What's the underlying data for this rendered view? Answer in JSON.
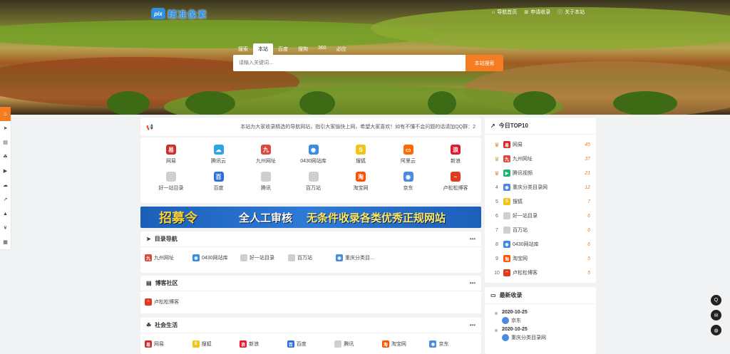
{
  "header": {
    "logo_badge": "pix",
    "logo_text": "精准像素",
    "nav": [
      {
        "icon": "home-icon",
        "glyph": "⌂",
        "label": "导航首页"
      },
      {
        "icon": "plus-square-icon",
        "glyph": "⊞",
        "label": "申请收录"
      },
      {
        "icon": "info-icon",
        "glyph": "ⓘ",
        "label": "关于本站"
      }
    ]
  },
  "search": {
    "tabs": [
      "搜索",
      "本站",
      "百度",
      "搜狗",
      "360",
      "必应"
    ],
    "active_tab": "本站",
    "placeholder": "请输入关键词...",
    "button_label": "本站搜索"
  },
  "notice": {
    "icon": "megaphone-icon",
    "text": "本站为大家收录精选的导航网站，指引大家愉快上网，希望大家喜欢！如有不懂不会问题的话请加QQ群：2"
  },
  "sites": [
    {
      "name": "网易",
      "color": "#d22b2b",
      "glyph": "易"
    },
    {
      "name": "腾讯云",
      "color": "#2fa3e7",
      "glyph": "☁"
    },
    {
      "name": "九州网址",
      "color": "#d94a3c",
      "glyph": "九"
    },
    {
      "name": "0430网站库",
      "color": "#3b8be0",
      "glyph": "◉"
    },
    {
      "name": "搜狐",
      "color": "#f0c419",
      "glyph": "S"
    },
    {
      "name": "阿里云",
      "color": "#ff6a00",
      "glyph": "▭"
    },
    {
      "name": "新浪",
      "color": "#e6162d",
      "glyph": "浪"
    },
    {
      "name": "好一站目录",
      "color": "#cfcfcf",
      "glyph": ""
    },
    {
      "name": "百度",
      "color": "#2d6fe0",
      "glyph": "百"
    },
    {
      "name": "腾讯",
      "color": "#cfcfcf",
      "glyph": ""
    },
    {
      "name": "百万站",
      "color": "#cfcfcf",
      "glyph": ""
    },
    {
      "name": "淘宝网",
      "color": "#ff5000",
      "glyph": "淘"
    },
    {
      "name": "京东",
      "color": "#4a8be0",
      "glyph": "◉"
    },
    {
      "name": "卢松松博客",
      "color": "#e03b1f",
      "glyph": "~"
    }
  ],
  "banner": {
    "part1": "招募令",
    "part2": "全人工审核",
    "part3": "无条件收录各类优秀正规网站"
  },
  "sections": [
    {
      "title": "目录导航",
      "icon": "paper-plane-icon",
      "glyph": "➤",
      "links": [
        {
          "name": "九州网址",
          "color": "#d94a3c",
          "glyph": "九"
        },
        {
          "name": "0430网站库",
          "color": "#3b8be0",
          "glyph": "◉"
        },
        {
          "name": "好一站目录",
          "color": "#cfcfcf",
          "glyph": ""
        },
        {
          "name": "百万站",
          "color": "#cfcfcf",
          "glyph": ""
        },
        {
          "name": "重庆分类目...",
          "color": "#4a8be0",
          "glyph": "◉"
        }
      ]
    },
    {
      "title": "博客社区",
      "icon": "document-icon",
      "glyph": "▤",
      "links": [
        {
          "name": "卢松松博客",
          "color": "#e03b1f",
          "glyph": "~"
        }
      ]
    },
    {
      "title": "社会生活",
      "icon": "users-icon",
      "glyph": "☘",
      "links": [
        {
          "name": "网易",
          "color": "#d22b2b",
          "glyph": "易"
        },
        {
          "name": "搜狐",
          "color": "#f0c419",
          "glyph": "S"
        },
        {
          "name": "新浪",
          "color": "#e6162d",
          "glyph": "浪"
        },
        {
          "name": "百度",
          "color": "#2d6fe0",
          "glyph": "百"
        },
        {
          "name": "腾讯",
          "color": "#cfcfcf",
          "glyph": ""
        },
        {
          "name": "淘宝网",
          "color": "#ff5000",
          "glyph": "淘"
        },
        {
          "name": "京东",
          "color": "#4a8be0",
          "glyph": "◉"
        }
      ]
    }
  ],
  "top10": {
    "title": "今日TOP10",
    "items": [
      {
        "rank": "1",
        "name": "网易",
        "count": "45",
        "color": "#d22b2b",
        "glyph": "易",
        "crown": true
      },
      {
        "rank": "2",
        "name": "九州网址",
        "count": "37",
        "color": "#d94a3c",
        "glyph": "九",
        "crown": true
      },
      {
        "rank": "3",
        "name": "腾讯视频",
        "count": "21",
        "color": "#20b36b",
        "glyph": "▶",
        "crown": true
      },
      {
        "rank": "4",
        "name": "重庆分类目录网",
        "count": "12",
        "color": "#4a8be0",
        "glyph": "◉",
        "crown": false
      },
      {
        "rank": "5",
        "name": "搜狐",
        "count": "7",
        "color": "#f0c419",
        "glyph": "S",
        "crown": false
      },
      {
        "rank": "6",
        "name": "好一站目录",
        "count": "6",
        "color": "#cfcfcf",
        "glyph": "",
        "crown": false
      },
      {
        "rank": "7",
        "name": "百万站",
        "count": "6",
        "color": "#cfcfcf",
        "glyph": "",
        "crown": false
      },
      {
        "rank": "8",
        "name": "0430网站库",
        "count": "6",
        "color": "#3b8be0",
        "glyph": "◉",
        "crown": false
      },
      {
        "rank": "9",
        "name": "淘宝网",
        "count": "5",
        "color": "#ff5000",
        "glyph": "淘",
        "crown": false
      },
      {
        "rank": "10",
        "name": "卢松松博客",
        "count": "5",
        "color": "#e03b1f",
        "glyph": "~",
        "crown": false
      }
    ]
  },
  "latest": {
    "title": "最新收录",
    "items": [
      {
        "date": "2020-10-25",
        "name": "京东",
        "color": "#4a8be0"
      },
      {
        "date": "2020-10-25",
        "name": "重庆分类目录网",
        "color": "#4a8be0"
      }
    ]
  },
  "left_tools": [
    {
      "icon": "fire-icon",
      "glyph": "♨"
    },
    {
      "icon": "paper-plane-icon",
      "glyph": "➤"
    },
    {
      "icon": "document-icon",
      "glyph": "▤"
    },
    {
      "icon": "users-icon",
      "glyph": "☘"
    },
    {
      "icon": "video-icon",
      "glyph": "▶"
    },
    {
      "icon": "cloud-icon",
      "glyph": "☁"
    },
    {
      "icon": "chart-icon",
      "glyph": "↗"
    },
    {
      "icon": "graduation-icon",
      "glyph": "▲"
    },
    {
      "icon": "yen-icon",
      "glyph": "¥"
    },
    {
      "icon": "grid-icon",
      "glyph": "▦"
    }
  ],
  "right_tools": [
    {
      "icon": "qq-icon",
      "glyph": "Q"
    },
    {
      "icon": "mail-icon",
      "glyph": "✉"
    },
    {
      "icon": "wechat-icon",
      "glyph": "◍"
    }
  ]
}
